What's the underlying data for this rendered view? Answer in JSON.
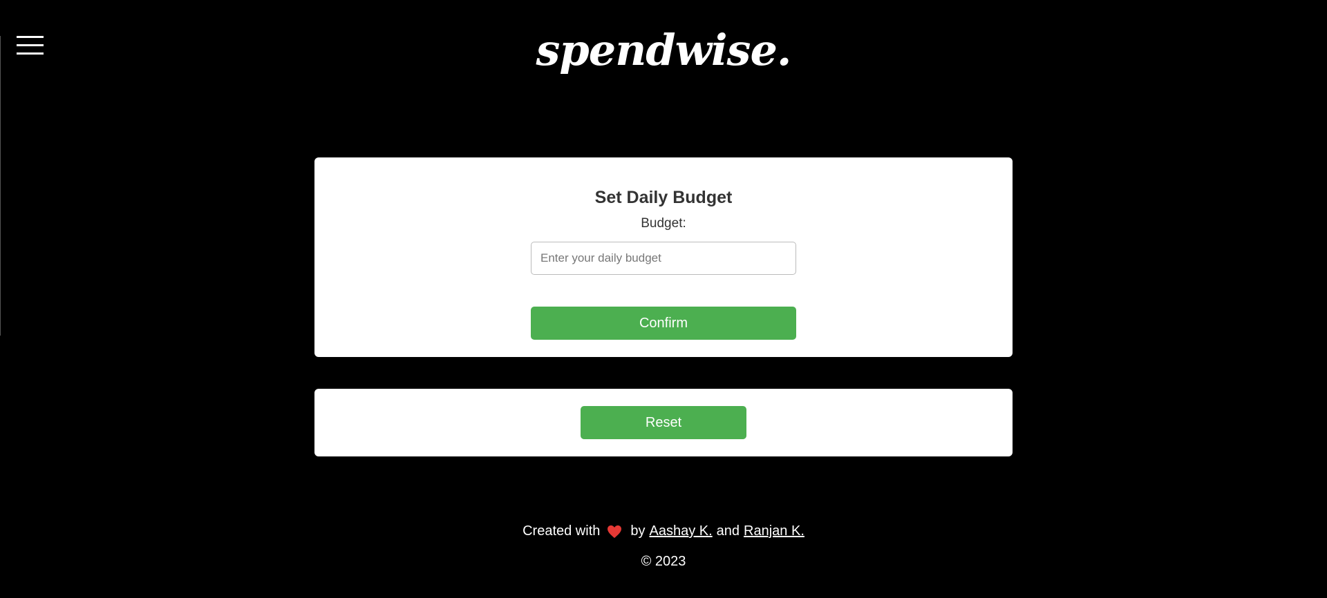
{
  "header": {
    "logo_text": "spendwise."
  },
  "budget_card": {
    "title": "Set Daily Budget",
    "label": "Budget:",
    "input_value": "",
    "input_placeholder": "Enter your daily budget",
    "confirm_label": "Confirm"
  },
  "reset_card": {
    "reset_label": "Reset"
  },
  "footer": {
    "created_with": "Created with",
    "by": "by",
    "author1": "Aashay K.",
    "and": "and",
    "author2": "Ranjan K.",
    "copyright": "© 2023"
  },
  "icons": {
    "menu": "hamburger-menu-icon",
    "heart": "heart-icon"
  },
  "colors": {
    "accent": "#4caf50",
    "heart": "#e53935",
    "background": "#000000"
  }
}
